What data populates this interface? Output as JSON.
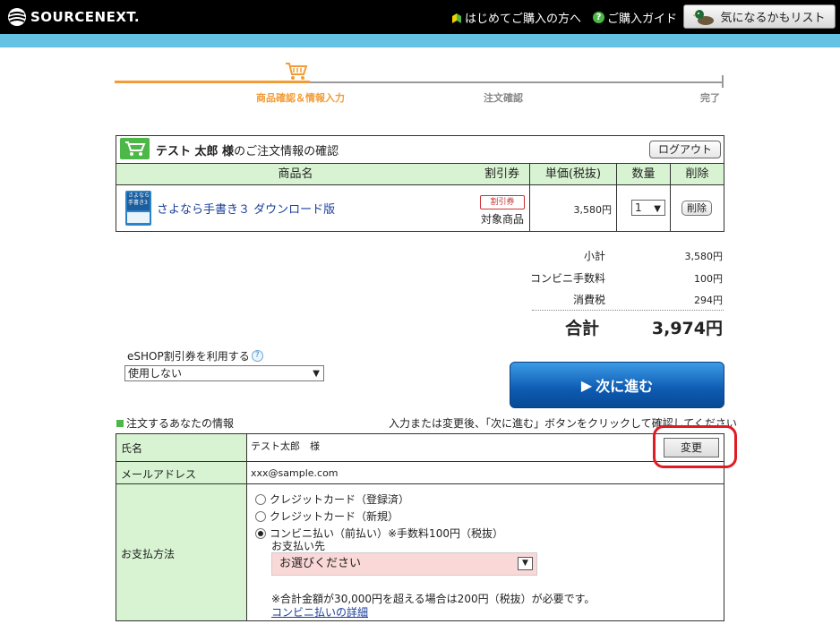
{
  "header": {
    "logo_text": "SOURCENEXT.",
    "link_first": "はじめてご購入の方へ",
    "link_guide": "ご購入ガイド",
    "wishlist": "気になるかもリスト"
  },
  "steps": [
    "商品確認＆情報入力",
    "注文確認",
    "完了"
  ],
  "order": {
    "customer": "テスト 太郎 様",
    "title_suffix": "のご注文情報の確認",
    "logout": "ログアウト",
    "columns": [
      "商品名",
      "割引券",
      "単価(税抜)",
      "数量",
      "削除"
    ],
    "product_name": "さよなら手書き３ ダウンロード版",
    "product_icon_text": "さよなら手書き3",
    "coupon_icon": "割引券",
    "coupon_label": "対象商品",
    "unit_price": "3,580円",
    "qty": "1",
    "delete": "削除"
  },
  "totals": {
    "subtotal_label": "小計",
    "subtotal": "3,580円",
    "fee_label": "コンビニ手数料",
    "fee": "100円",
    "tax_label": "消費税",
    "tax": "294円",
    "total_label": "合計",
    "total": "3,974円"
  },
  "eshop": {
    "label": "eSHOP割引券を利用する",
    "selected": "使用しない"
  },
  "next_button": "次に進む",
  "info": {
    "heading": "注文するあなたの情報",
    "note": "入力または変更後、「次に進む」ボタンをクリックして確認してください",
    "name_label": "氏名",
    "name_value": "テスト太郎　様",
    "change": "変更",
    "email_label": "メールアドレス",
    "email_value": "xxx@sample.com",
    "payment_label": "お支払方法",
    "payment_options": [
      "クレジットカード（登録済）",
      "クレジットカード（新規）",
      "コンビニ払い（前払い）※手数料100円（税抜）"
    ],
    "pay_to_label": "お支払い先",
    "pay_to_selected": "お選びください",
    "pay_note": "※合計金額が30,000円を超える場合は200円（税抜）が必要です。",
    "pay_detail_link": "コンビニ払いの詳細"
  },
  "colors": {
    "accent_orange": "#f39c35",
    "header_band": "#66c2e4",
    "table_green": "#d8f3d2",
    "button_blue": "#0d5bb2",
    "highlight_red": "#e01b24"
  }
}
